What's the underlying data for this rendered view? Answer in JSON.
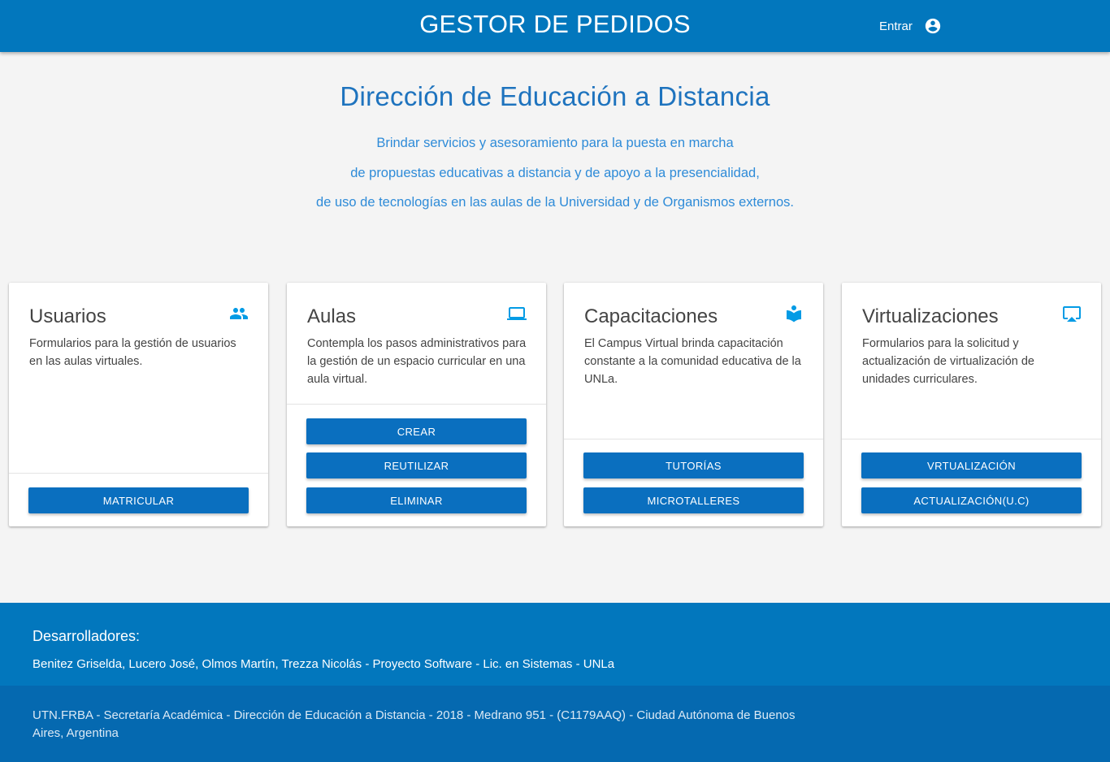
{
  "header": {
    "title": "GESTOR DE PEDIDOS",
    "login_label": "Entrar",
    "login_icon": "account-circle-icon"
  },
  "hero": {
    "title": "Dirección de Educación a Distancia",
    "lines": [
      "Brindar servicios y asesoramiento para la puesta en marcha",
      "de propuestas educativas a distancia y de apoyo a la presencialidad,",
      "de uso de tecnologías en las aulas de la Universidad y de Organismos externos."
    ]
  },
  "cards": [
    {
      "title": "Usuarios",
      "icon": "people-icon",
      "description": "Formularios para la gestión de usuarios en las aulas virtuales.",
      "buttons": [
        "MATRICULAR"
      ]
    },
    {
      "title": "Aulas",
      "icon": "laptop-icon",
      "description": "Contempla los pasos administrativos para la gestión de un espacio curricular en una aula virtual.",
      "buttons": [
        "CREAR",
        "REUTILIZAR",
        "ELIMINAR"
      ]
    },
    {
      "title": "Capacitaciones",
      "icon": "reader-icon",
      "description": "El Campus Virtual brinda capacitación constante a la comunidad educativa de la UNLa.",
      "buttons": [
        "TUTORÍAS",
        "MICROTALLERES"
      ]
    },
    {
      "title": "Virtualizaciones",
      "icon": "airplay-icon",
      "description": "Formularios para la solicitud y actualización de virtualización de unidades curriculares.",
      "buttons": [
        "VRTUALIZACIÓN",
        "ACTUALIZACIÓN(U.C)"
      ]
    }
  ],
  "footer": {
    "heading": "Desarrolladores:",
    "credits": "Benitez Griselda, Lucero José, Olmos Martín, Trezza Nicolás - Proyecto Software - Lic. en Sistemas - UNLa",
    "address": "UTN.FRBA - Secretaría Académica - Dirección de Educación a Distancia - 2018 - Medrano 951 - (C1179AAQ) - Ciudad Autónoma de Buenos Aires, Argentina"
  },
  "colors": {
    "primary": "#0277bd",
    "button": "#0a6fbf",
    "accent_icon": "#039be5",
    "hero_title": "#1e73be",
    "background": "#f4f4f4"
  }
}
